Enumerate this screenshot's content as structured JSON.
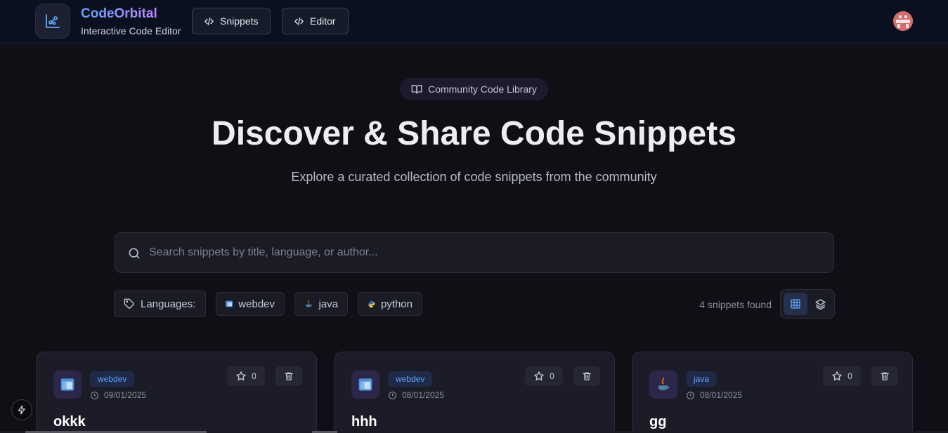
{
  "app": {
    "name": "CodeOrbital",
    "tagline": "Interactive Code Editor",
    "nav": [
      {
        "label": "Snippets",
        "icon": "code-icon"
      },
      {
        "label": "Editor",
        "icon": "code-icon"
      }
    ],
    "avatar_icon": "user-avatar"
  },
  "hero": {
    "badge": "Community Code Library",
    "badge_icon": "book-open-icon",
    "title": "Discover & Share Code Snippets",
    "subtitle": "Explore a curated collection of code snippets from the community"
  },
  "search": {
    "placeholder": "Search snippets by title, language, or author...",
    "value": ""
  },
  "filters": {
    "label": "Languages:",
    "languages": [
      {
        "name": "webdev",
        "icon": "webdev-icon"
      },
      {
        "name": "java",
        "icon": "java-icon"
      },
      {
        "name": "python",
        "icon": "python-icon"
      }
    ],
    "count_text": "4 snippets found",
    "views": [
      "grid-view",
      "list-view"
    ]
  },
  "snippets": [
    {
      "language": "webdev",
      "date": "09/01/2025",
      "stars": "0",
      "title": "okkk"
    },
    {
      "language": "webdev",
      "date": "08/01/2025",
      "stars": "0",
      "title": "hhh"
    },
    {
      "language": "java",
      "date": "08/01/2025",
      "stars": "0",
      "title": "gg"
    }
  ],
  "colors": {
    "background": "#0f0f15",
    "accent_blue": "#60a5fa",
    "accent_purple": "#c084fc"
  }
}
